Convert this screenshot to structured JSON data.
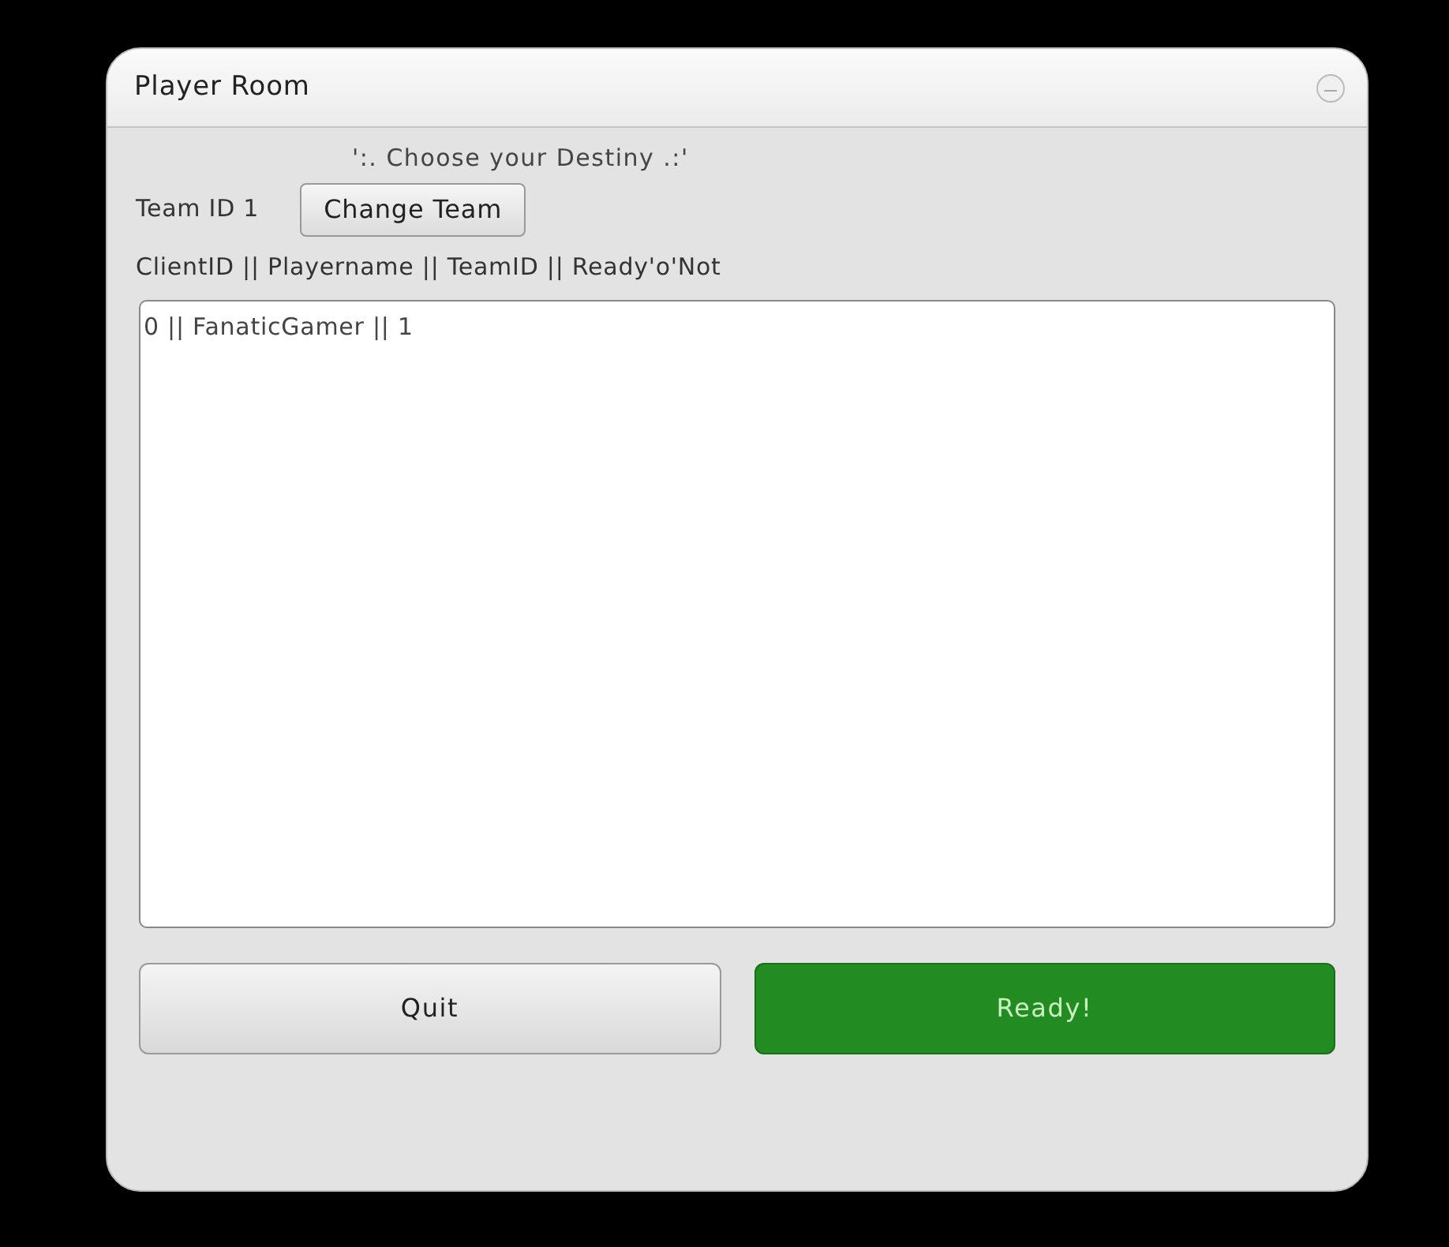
{
  "window": {
    "title": "Player Room"
  },
  "subtitle": "':. Choose your Destiny .:'",
  "team": {
    "label": "Team ID 1",
    "button": "Change Team"
  },
  "list_header": "ClientID || Playername || TeamID || Ready'o'Not",
  "players": [
    "0 || FanaticGamer || 1"
  ],
  "buttons": [
    {
      "label": "Quit",
      "kind": "default"
    },
    {
      "label": "Ready!",
      "kind": "primary"
    }
  ]
}
